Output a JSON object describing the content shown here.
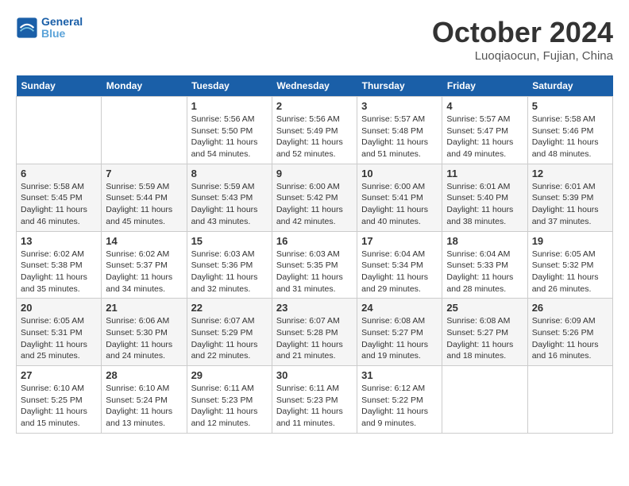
{
  "header": {
    "logo_line1": "General",
    "logo_line2": "Blue",
    "month": "October 2024",
    "location": "Luoqiaocun, Fujian, China"
  },
  "weekdays": [
    "Sunday",
    "Monday",
    "Tuesday",
    "Wednesday",
    "Thursday",
    "Friday",
    "Saturday"
  ],
  "weeks": [
    [
      {
        "day": "",
        "sunrise": "",
        "sunset": "",
        "daylight": ""
      },
      {
        "day": "",
        "sunrise": "",
        "sunset": "",
        "daylight": ""
      },
      {
        "day": "1",
        "sunrise": "Sunrise: 5:56 AM",
        "sunset": "Sunset: 5:50 PM",
        "daylight": "Daylight: 11 hours and 54 minutes."
      },
      {
        "day": "2",
        "sunrise": "Sunrise: 5:56 AM",
        "sunset": "Sunset: 5:49 PM",
        "daylight": "Daylight: 11 hours and 52 minutes."
      },
      {
        "day": "3",
        "sunrise": "Sunrise: 5:57 AM",
        "sunset": "Sunset: 5:48 PM",
        "daylight": "Daylight: 11 hours and 51 minutes."
      },
      {
        "day": "4",
        "sunrise": "Sunrise: 5:57 AM",
        "sunset": "Sunset: 5:47 PM",
        "daylight": "Daylight: 11 hours and 49 minutes."
      },
      {
        "day": "5",
        "sunrise": "Sunrise: 5:58 AM",
        "sunset": "Sunset: 5:46 PM",
        "daylight": "Daylight: 11 hours and 48 minutes."
      }
    ],
    [
      {
        "day": "6",
        "sunrise": "Sunrise: 5:58 AM",
        "sunset": "Sunset: 5:45 PM",
        "daylight": "Daylight: 11 hours and 46 minutes."
      },
      {
        "day": "7",
        "sunrise": "Sunrise: 5:59 AM",
        "sunset": "Sunset: 5:44 PM",
        "daylight": "Daylight: 11 hours and 45 minutes."
      },
      {
        "day": "8",
        "sunrise": "Sunrise: 5:59 AM",
        "sunset": "Sunset: 5:43 PM",
        "daylight": "Daylight: 11 hours and 43 minutes."
      },
      {
        "day": "9",
        "sunrise": "Sunrise: 6:00 AM",
        "sunset": "Sunset: 5:42 PM",
        "daylight": "Daylight: 11 hours and 42 minutes."
      },
      {
        "day": "10",
        "sunrise": "Sunrise: 6:00 AM",
        "sunset": "Sunset: 5:41 PM",
        "daylight": "Daylight: 11 hours and 40 minutes."
      },
      {
        "day": "11",
        "sunrise": "Sunrise: 6:01 AM",
        "sunset": "Sunset: 5:40 PM",
        "daylight": "Daylight: 11 hours and 38 minutes."
      },
      {
        "day": "12",
        "sunrise": "Sunrise: 6:01 AM",
        "sunset": "Sunset: 5:39 PM",
        "daylight": "Daylight: 11 hours and 37 minutes."
      }
    ],
    [
      {
        "day": "13",
        "sunrise": "Sunrise: 6:02 AM",
        "sunset": "Sunset: 5:38 PM",
        "daylight": "Daylight: 11 hours and 35 minutes."
      },
      {
        "day": "14",
        "sunrise": "Sunrise: 6:02 AM",
        "sunset": "Sunset: 5:37 PM",
        "daylight": "Daylight: 11 hours and 34 minutes."
      },
      {
        "day": "15",
        "sunrise": "Sunrise: 6:03 AM",
        "sunset": "Sunset: 5:36 PM",
        "daylight": "Daylight: 11 hours and 32 minutes."
      },
      {
        "day": "16",
        "sunrise": "Sunrise: 6:03 AM",
        "sunset": "Sunset: 5:35 PM",
        "daylight": "Daylight: 11 hours and 31 minutes."
      },
      {
        "day": "17",
        "sunrise": "Sunrise: 6:04 AM",
        "sunset": "Sunset: 5:34 PM",
        "daylight": "Daylight: 11 hours and 29 minutes."
      },
      {
        "day": "18",
        "sunrise": "Sunrise: 6:04 AM",
        "sunset": "Sunset: 5:33 PM",
        "daylight": "Daylight: 11 hours and 28 minutes."
      },
      {
        "day": "19",
        "sunrise": "Sunrise: 6:05 AM",
        "sunset": "Sunset: 5:32 PM",
        "daylight": "Daylight: 11 hours and 26 minutes."
      }
    ],
    [
      {
        "day": "20",
        "sunrise": "Sunrise: 6:05 AM",
        "sunset": "Sunset: 5:31 PM",
        "daylight": "Daylight: 11 hours and 25 minutes."
      },
      {
        "day": "21",
        "sunrise": "Sunrise: 6:06 AM",
        "sunset": "Sunset: 5:30 PM",
        "daylight": "Daylight: 11 hours and 24 minutes."
      },
      {
        "day": "22",
        "sunrise": "Sunrise: 6:07 AM",
        "sunset": "Sunset: 5:29 PM",
        "daylight": "Daylight: 11 hours and 22 minutes."
      },
      {
        "day": "23",
        "sunrise": "Sunrise: 6:07 AM",
        "sunset": "Sunset: 5:28 PM",
        "daylight": "Daylight: 11 hours and 21 minutes."
      },
      {
        "day": "24",
        "sunrise": "Sunrise: 6:08 AM",
        "sunset": "Sunset: 5:27 PM",
        "daylight": "Daylight: 11 hours and 19 minutes."
      },
      {
        "day": "25",
        "sunrise": "Sunrise: 6:08 AM",
        "sunset": "Sunset: 5:27 PM",
        "daylight": "Daylight: 11 hours and 18 minutes."
      },
      {
        "day": "26",
        "sunrise": "Sunrise: 6:09 AM",
        "sunset": "Sunset: 5:26 PM",
        "daylight": "Daylight: 11 hours and 16 minutes."
      }
    ],
    [
      {
        "day": "27",
        "sunrise": "Sunrise: 6:10 AM",
        "sunset": "Sunset: 5:25 PM",
        "daylight": "Daylight: 11 hours and 15 minutes."
      },
      {
        "day": "28",
        "sunrise": "Sunrise: 6:10 AM",
        "sunset": "Sunset: 5:24 PM",
        "daylight": "Daylight: 11 hours and 13 minutes."
      },
      {
        "day": "29",
        "sunrise": "Sunrise: 6:11 AM",
        "sunset": "Sunset: 5:23 PM",
        "daylight": "Daylight: 11 hours and 12 minutes."
      },
      {
        "day": "30",
        "sunrise": "Sunrise: 6:11 AM",
        "sunset": "Sunset: 5:23 PM",
        "daylight": "Daylight: 11 hours and 11 minutes."
      },
      {
        "day": "31",
        "sunrise": "Sunrise: 6:12 AM",
        "sunset": "Sunset: 5:22 PM",
        "daylight": "Daylight: 11 hours and 9 minutes."
      },
      {
        "day": "",
        "sunrise": "",
        "sunset": "",
        "daylight": ""
      },
      {
        "day": "",
        "sunrise": "",
        "sunset": "",
        "daylight": ""
      }
    ]
  ]
}
